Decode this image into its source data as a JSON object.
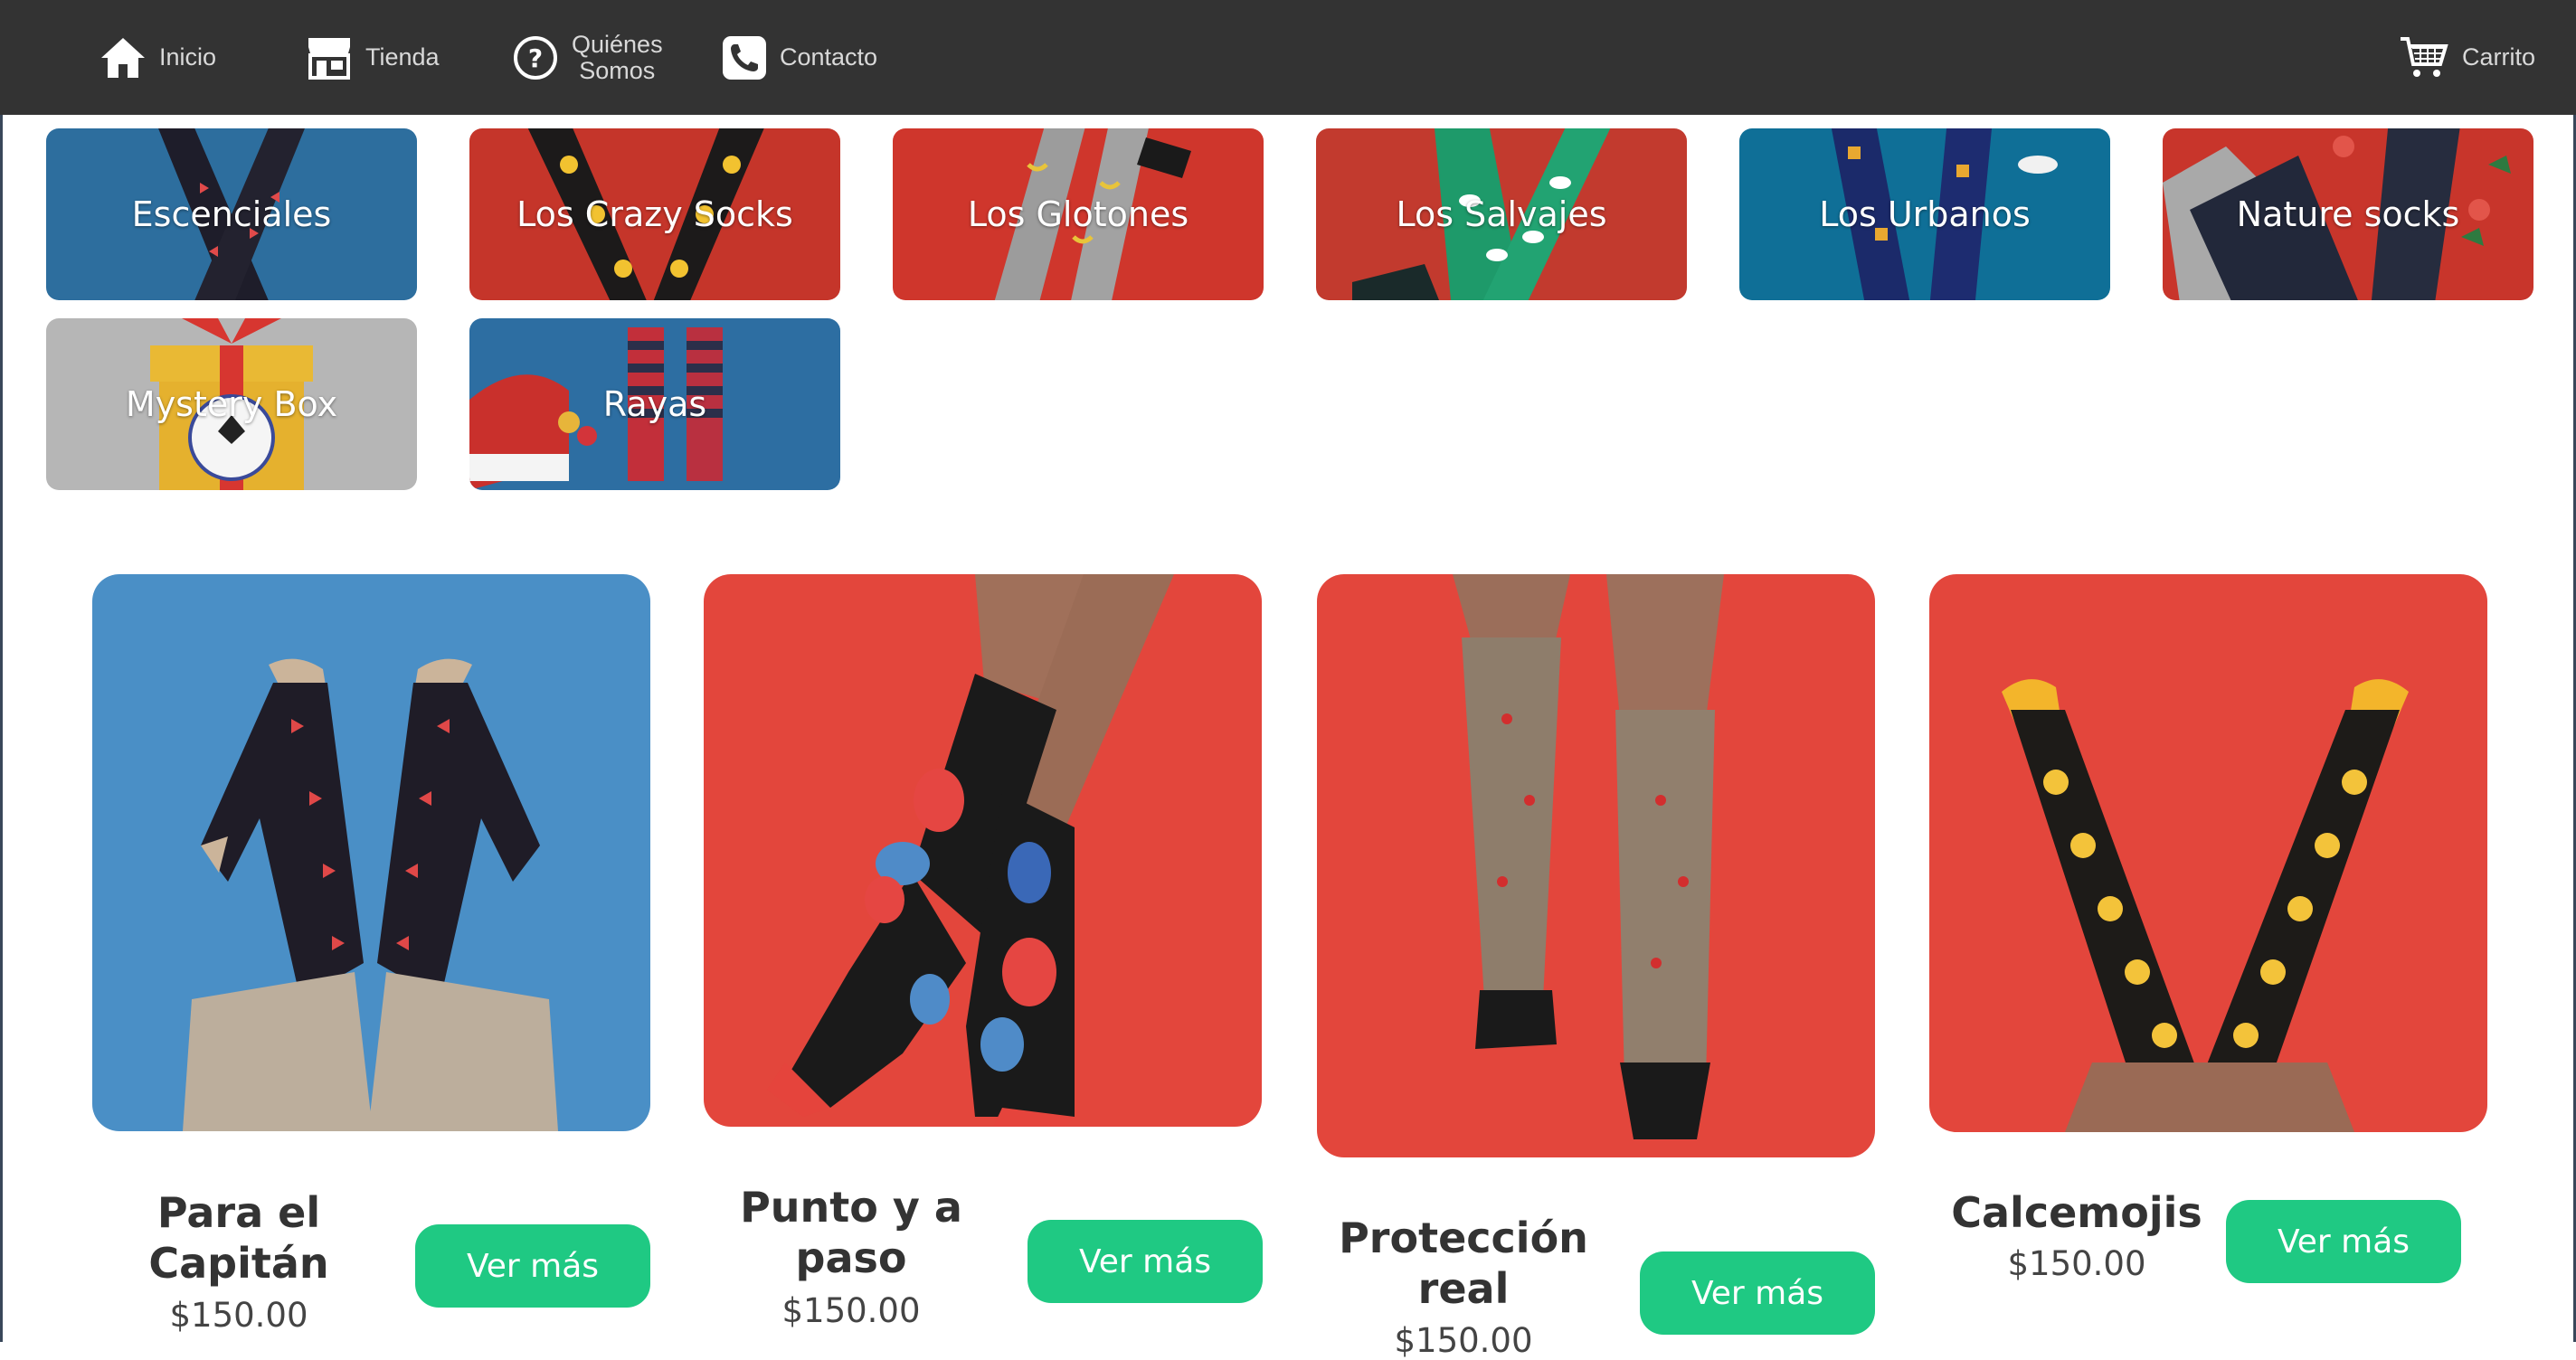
{
  "nav": {
    "items": [
      {
        "label": "Inicio",
        "icon": "home-icon"
      },
      {
        "label": "Tienda",
        "icon": "store-icon"
      },
      {
        "label_line1": "Quiénes",
        "label_line2": "Somos",
        "icon": "question-circle-icon"
      },
      {
        "label": "Contacto",
        "icon": "phone-icon"
      }
    ],
    "cart": {
      "label": "Carrito",
      "icon": "cart-icon"
    }
  },
  "categories": [
    {
      "label": "Escenciales",
      "bg": "#2d6e9e"
    },
    {
      "label": "Los Crazy Socks",
      "bg": "#c5352a"
    },
    {
      "label": "Los Glotones",
      "bg": "#cf362c"
    },
    {
      "label": "Los Salvajes",
      "bg": "#c23a2e"
    },
    {
      "label": "Los Urbanos",
      "bg": "#0f6f97"
    },
    {
      "label": "Nature socks",
      "bg": "#c8352b"
    },
    {
      "label": "Mystery Box",
      "bg": "#b6b6b6"
    },
    {
      "label": "Rayas",
      "bg": "#2d6ea2"
    }
  ],
  "products": [
    {
      "name_line1": "Para el",
      "name_line2": "Capitán",
      "price": "$150.00",
      "button": "Ver más",
      "bg": "#4a8fc6"
    },
    {
      "name_line1": "Punto y a",
      "name_line2": "paso",
      "price": "$150.00",
      "button": "Ver más",
      "bg": "#e3463c"
    },
    {
      "name_line1": "Protección",
      "name_line2": "real",
      "price": "$150.00",
      "button": "Ver más",
      "bg": "#e3463c"
    },
    {
      "name_line1": "Calcemojis",
      "price": "$150.00",
      "button": "Ver más",
      "bg": "#e3463c"
    }
  ],
  "colors": {
    "nav_bg": "#333333",
    "accent_green": "#1fc983",
    "text_dark": "#333333"
  }
}
